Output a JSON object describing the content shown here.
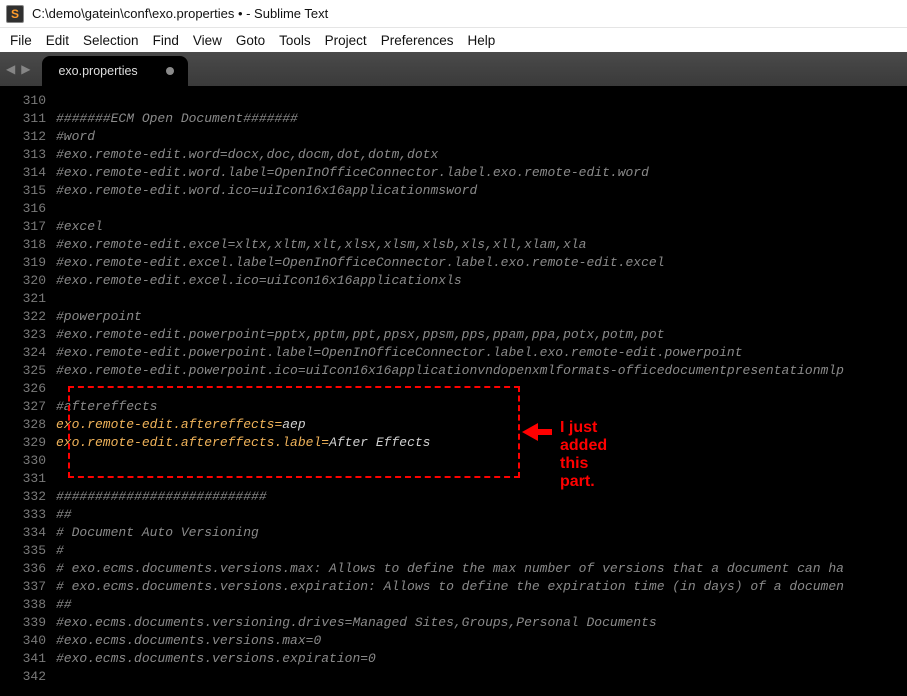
{
  "window": {
    "title": "C:\\demo\\gatein\\conf\\exo.properties • - Sublime Text"
  },
  "menu": {
    "items": [
      "File",
      "Edit",
      "Selection",
      "Find",
      "View",
      "Goto",
      "Tools",
      "Project",
      "Preferences",
      "Help"
    ]
  },
  "tab": {
    "label": "exo.properties",
    "dirty": true
  },
  "editor": {
    "first_line_number": 310,
    "lines": [
      {
        "n": 310,
        "type": "blank",
        "text": ""
      },
      {
        "n": 311,
        "type": "cmt",
        "text": "#######ECM Open Document#######"
      },
      {
        "n": 312,
        "type": "cmt",
        "text": "#word"
      },
      {
        "n": 313,
        "type": "cmt",
        "text": "#exo.remote-edit.word=docx,doc,docm,dot,dotm,dotx"
      },
      {
        "n": 314,
        "type": "cmt",
        "text": "#exo.remote-edit.word.label=OpenInOfficeConnector.label.exo.remote-edit.word"
      },
      {
        "n": 315,
        "type": "cmt",
        "text": "#exo.remote-edit.word.ico=uiIcon16x16applicationmsword"
      },
      {
        "n": 316,
        "type": "blank",
        "text": ""
      },
      {
        "n": 317,
        "type": "cmt",
        "text": "#excel"
      },
      {
        "n": 318,
        "type": "cmt",
        "text": "#exo.remote-edit.excel=xltx,xltm,xlt,xlsx,xlsm,xlsb,xls,xll,xlam,xla"
      },
      {
        "n": 319,
        "type": "cmt",
        "text": "#exo.remote-edit.excel.label=OpenInOfficeConnector.label.exo.remote-edit.excel"
      },
      {
        "n": 320,
        "type": "cmt",
        "text": "#exo.remote-edit.excel.ico=uiIcon16x16applicationxls"
      },
      {
        "n": 321,
        "type": "blank",
        "text": ""
      },
      {
        "n": 322,
        "type": "cmt",
        "text": "#powerpoint"
      },
      {
        "n": 323,
        "type": "cmt",
        "text": "#exo.remote-edit.powerpoint=pptx,pptm,ppt,ppsx,ppsm,pps,ppam,ppa,potx,potm,pot"
      },
      {
        "n": 324,
        "type": "cmt",
        "text": "#exo.remote-edit.powerpoint.label=OpenInOfficeConnector.label.exo.remote-edit.powerpoint"
      },
      {
        "n": 325,
        "type": "cmt",
        "text": "#exo.remote-edit.powerpoint.ico=uiIcon16x16applicationvndopenxmlformats-officedocumentpresentationmlp"
      },
      {
        "n": 326,
        "type": "blank",
        "text": ""
      },
      {
        "n": 327,
        "type": "cmt",
        "text": "#aftereffects"
      },
      {
        "n": 328,
        "type": "kv",
        "key": "exo.remote-edit.aftereffects",
        "val": "aep"
      },
      {
        "n": 329,
        "type": "kv",
        "key": "exo.remote-edit.aftereffects.label",
        "val": "After Effects"
      },
      {
        "n": 330,
        "type": "blank",
        "text": ""
      },
      {
        "n": 331,
        "type": "blank",
        "text": ""
      },
      {
        "n": 332,
        "type": "cmt",
        "text": "###########################"
      },
      {
        "n": 333,
        "type": "cmt",
        "text": "##"
      },
      {
        "n": 334,
        "type": "cmt",
        "text": "# Document Auto Versioning"
      },
      {
        "n": 335,
        "type": "cmt",
        "text": "#"
      },
      {
        "n": 336,
        "type": "cmt",
        "text": "# exo.ecms.documents.versions.max: Allows to define the max number of versions that a document can ha"
      },
      {
        "n": 337,
        "type": "cmt",
        "text": "# exo.ecms.documents.versions.expiration: Allows to define the expiration time (in days) of a documen"
      },
      {
        "n": 338,
        "type": "cmt",
        "text": "##"
      },
      {
        "n": 339,
        "type": "cmt",
        "text": "#exo.ecms.documents.versioning.drives=Managed Sites,Groups,Personal Documents"
      },
      {
        "n": 340,
        "type": "cmt",
        "text": "#exo.ecms.documents.versions.max=0"
      },
      {
        "n": 341,
        "type": "cmt",
        "text": "#exo.ecms.documents.versions.expiration=0"
      },
      {
        "n": 342,
        "type": "blank",
        "text": ""
      }
    ]
  },
  "annotation": {
    "text": "I just added this part."
  }
}
